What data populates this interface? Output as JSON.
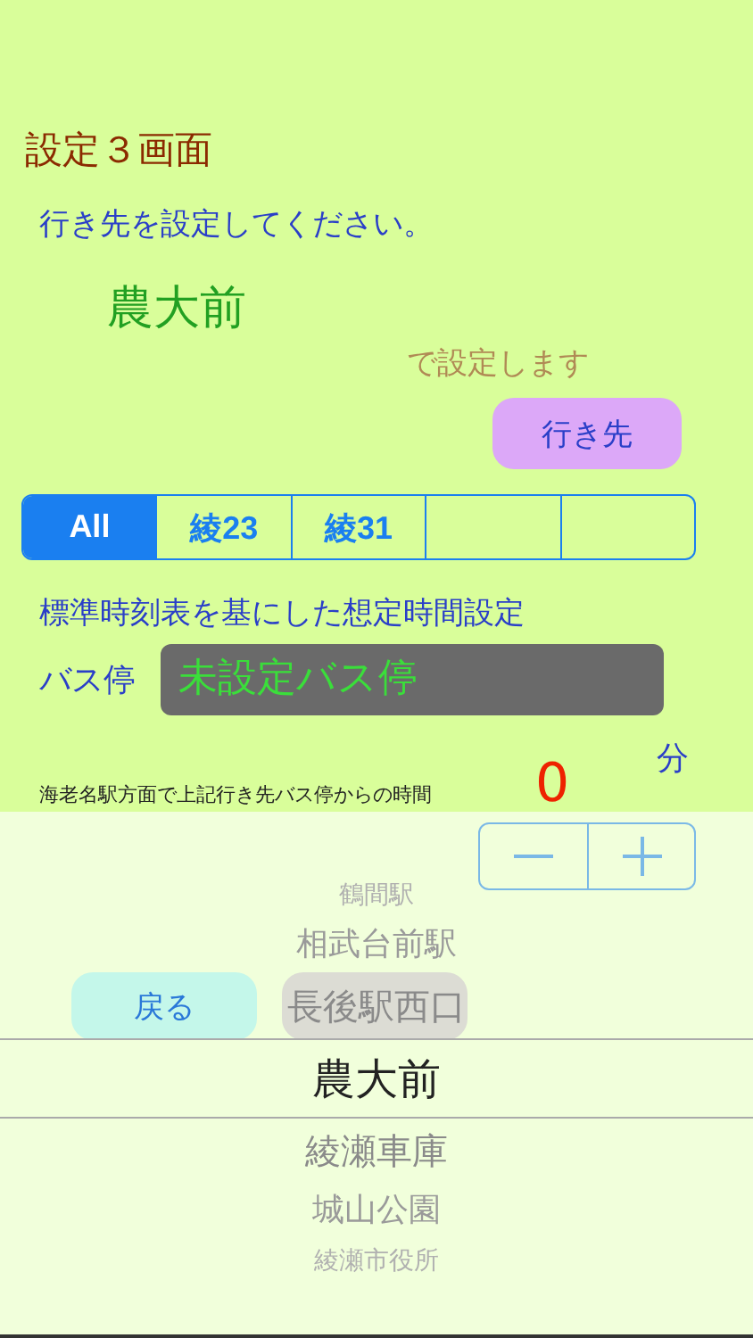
{
  "title": "設定３画面",
  "prompt": "行き先を設定してください。",
  "destination": "農大前",
  "suffix": "で設定します",
  "destination_button": "行き先",
  "segments": [
    {
      "label": "All",
      "selected": true
    },
    {
      "label": "綾23",
      "selected": false
    },
    {
      "label": "綾31",
      "selected": false
    },
    {
      "selected": false
    },
    {
      "selected": false
    }
  ],
  "section_title": "標準時刻表を基にした想定時間設定",
  "bus_stop": {
    "label": "バス停",
    "value": "未設定バス停"
  },
  "time_note": "海老名駅方面で上記行き先バス停からの時間",
  "minutes": {
    "value": "0",
    "unit": "分"
  },
  "back_button": "戻る",
  "picker": [
    {
      "label": "鶴間駅",
      "selected": false
    },
    {
      "label": "相武台前駅",
      "selected": false
    },
    {
      "label": "長後駅西口",
      "selected": false
    },
    {
      "label": "農大前",
      "selected": true
    },
    {
      "label": "綾瀬車庫",
      "selected": false
    },
    {
      "label": "城山公園",
      "selected": false
    },
    {
      "label": "綾瀬市役所",
      "selected": false
    }
  ]
}
